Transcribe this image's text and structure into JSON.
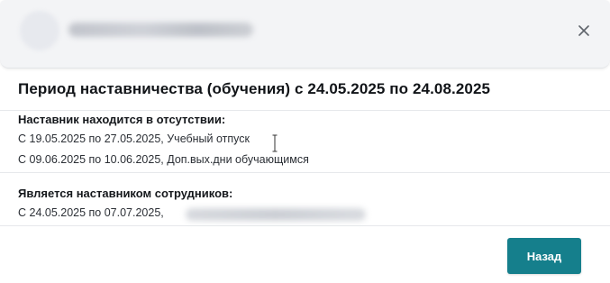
{
  "header": {
    "user_name_blurred": true,
    "close_icon": "close-icon"
  },
  "modal": {
    "title": "Период наставничества (обучения) с 24.05.2025 по 24.08.2025"
  },
  "absence": {
    "heading": "Наставник находится в отсутствии:",
    "entries": [
      "С 19.05.2025 по 27.05.2025, Учебный отпуск",
      "С 09.06.2025 по 10.06.2025, Доп.вых.дни обучающимся"
    ]
  },
  "mentoring": {
    "heading": "Является наставником сотрудников:",
    "entries": [
      "С 24.05.2025 по 07.07.2025,"
    ],
    "mentee_name_blurred": true
  },
  "footer": {
    "back_label": "Назад"
  },
  "colors": {
    "primary": "#157f8c",
    "header_bg": "#f3f4f6",
    "divider": "#e6e8eb"
  }
}
